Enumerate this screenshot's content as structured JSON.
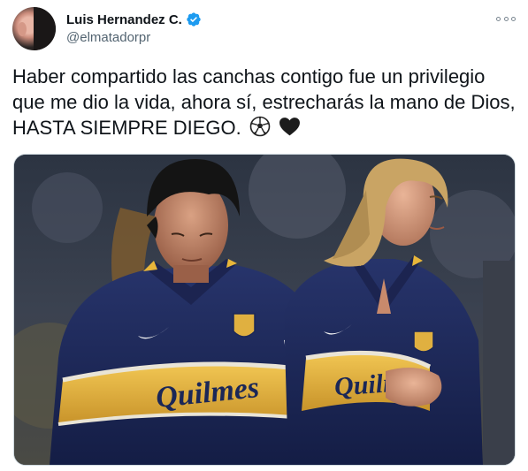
{
  "author": {
    "display_name": "Luis Hernandez C.",
    "handle": "@elmatadorpr",
    "verified_icon": "verified-badge-icon",
    "avatar_icon": "avatar"
  },
  "tweet": {
    "text": "Haber compartido las canchas contigo fue un privilegio que me dio la vida, ahora sí, estrecharás la mano de Dios, HASTA SIEMPRE DIEGO.",
    "emojis": [
      "soccer-ball-icon",
      "black-heart-icon"
    ]
  },
  "media": {
    "shirt_sponsor_left": "Quilmes",
    "shirt_sponsor_right": "Quilmes"
  },
  "colors": {
    "verified_blue": "#1d9bf0",
    "handle_gray": "#536471",
    "jersey_navy": "#1b2757",
    "jersey_yellow": "#e8b63a"
  }
}
